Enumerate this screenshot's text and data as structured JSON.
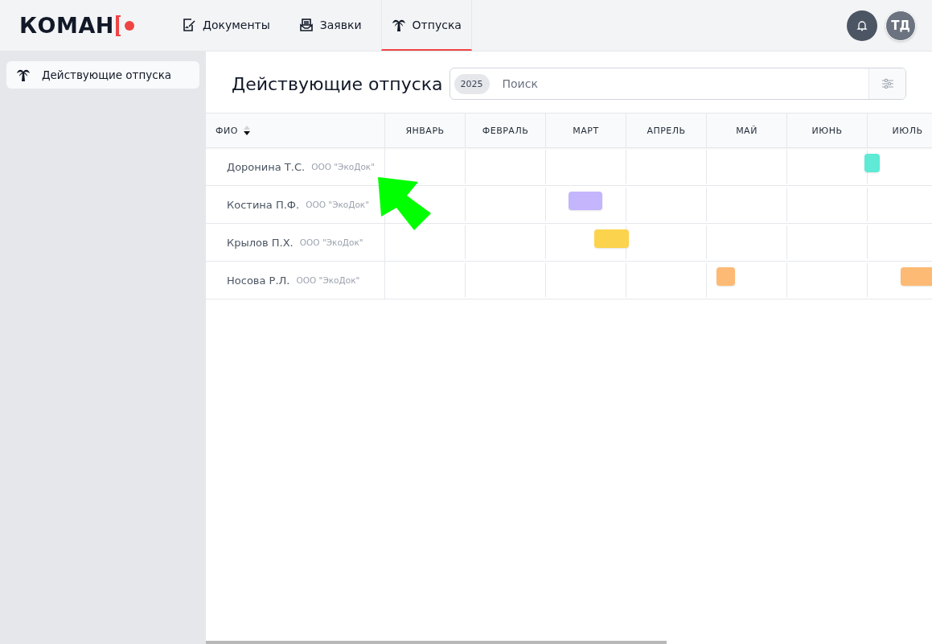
{
  "logo": {
    "text": "КОМАН"
  },
  "nav": [
    {
      "label": "Документы",
      "selected": false
    },
    {
      "label": "Заявки",
      "selected": false
    },
    {
      "label": "Отпуска",
      "selected": true
    }
  ],
  "user": {
    "initials": "ТД"
  },
  "sidebar": {
    "items": [
      {
        "label": "Действующие отпуска",
        "selected": true
      }
    ]
  },
  "page": {
    "title": "Действующие отпуска",
    "year": "2025",
    "search": {
      "placeholder": "Поиск"
    }
  },
  "table": {
    "name_column": {
      "label": "ФИО",
      "sorted_descending": true
    },
    "months": [
      "ЯНВАРЬ",
      "ФЕВРАЛЬ",
      "МАРТ",
      "АПРЕЛЬ",
      "МАЙ",
      "ИЮНЬ",
      "ИЮЛЬ"
    ],
    "rows": [
      {
        "name": "Доронина Т.С.",
        "company": "ООО \"ЭкоДок\"",
        "vacations": [
          {
            "color": "#5eead4"
          }
        ]
      },
      {
        "name": "Костина П.Ф.",
        "company": "ООО \"ЭкоДок\"",
        "vacations": [
          {
            "color": "#c4b5fd"
          }
        ]
      },
      {
        "name": "Крылов П.Х.",
        "company": "ООО \"ЭкоДок\"",
        "vacations": [
          {
            "color": "#fcd34d"
          }
        ]
      },
      {
        "name": "Носова Р.Л.",
        "company": "ООО \"ЭкоДок\"",
        "vacations": [
          {
            "color": "#fdba74"
          },
          {
            "color": "#fdba74"
          }
        ]
      }
    ]
  },
  "annotation": {
    "kind": "arrow",
    "color": "#00ff00"
  }
}
